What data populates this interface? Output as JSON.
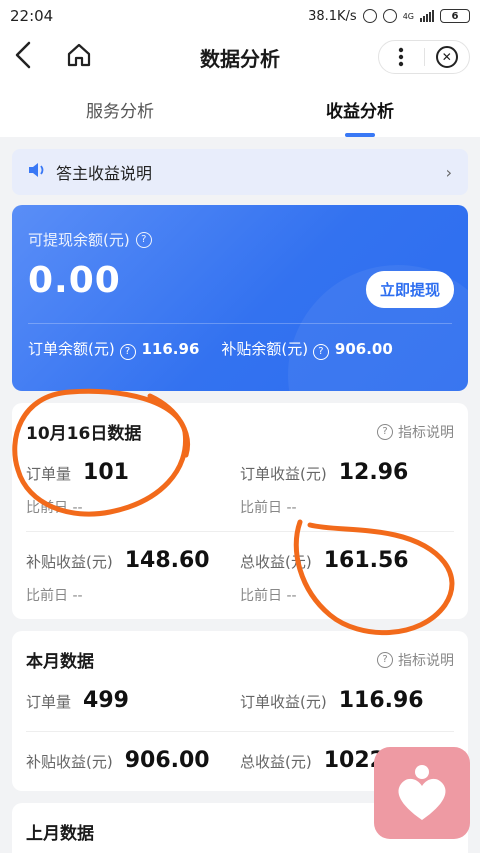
{
  "status_bar": {
    "time": "22:04",
    "network_speed": "38.1K/s",
    "signal_label": "4G",
    "battery": "6"
  },
  "nav": {
    "title": "数据分析"
  },
  "tabs": [
    {
      "label": "服务分析",
      "active": false
    },
    {
      "label": "收益分析",
      "active": true
    }
  ],
  "notice": {
    "text": "答主收益说明"
  },
  "balance": {
    "label": "可提现余额(元)",
    "amount": "0.00",
    "withdraw_label": "立即提现",
    "order_balance_label": "订单余额(元)",
    "order_balance_value": "116.96",
    "subsidy_balance_label": "补贴余额(元)",
    "subsidy_balance_value": "906.00"
  },
  "day_card": {
    "title": "10月16日数据",
    "help": "指标说明",
    "order_count_label": "订单量",
    "order_count_value": "101",
    "order_count_cmp": "比前日 --",
    "order_income_label": "订单收益(元)",
    "order_income_value": "12.96",
    "order_income_cmp": "比前日 --",
    "subsidy_income_label": "补贴收益(元)",
    "subsidy_income_value": "148.60",
    "subsidy_income_cmp": "比前日 --",
    "total_income_label": "总收益(元)",
    "total_income_value": "161.56",
    "total_income_cmp": "比前日 --"
  },
  "month_card": {
    "title": "本月数据",
    "help": "指标说明",
    "order_count_label": "订单量",
    "order_count_value": "499",
    "order_income_label": "订单收益(元)",
    "order_income_value": "116.96",
    "subsidy_income_label": "补贴收益(元)",
    "subsidy_income_value": "906.00",
    "total_income_label": "总收益(元)",
    "total_income_value": "1022"
  },
  "last_month_card": {
    "title": "上月数据"
  },
  "colors": {
    "accent": "#3978f5",
    "card_gradient_start": "#5a8ef7",
    "card_gradient_end": "#2d6ef0",
    "annotation": "#f26a1b",
    "float_button": "#ee9aa3"
  }
}
